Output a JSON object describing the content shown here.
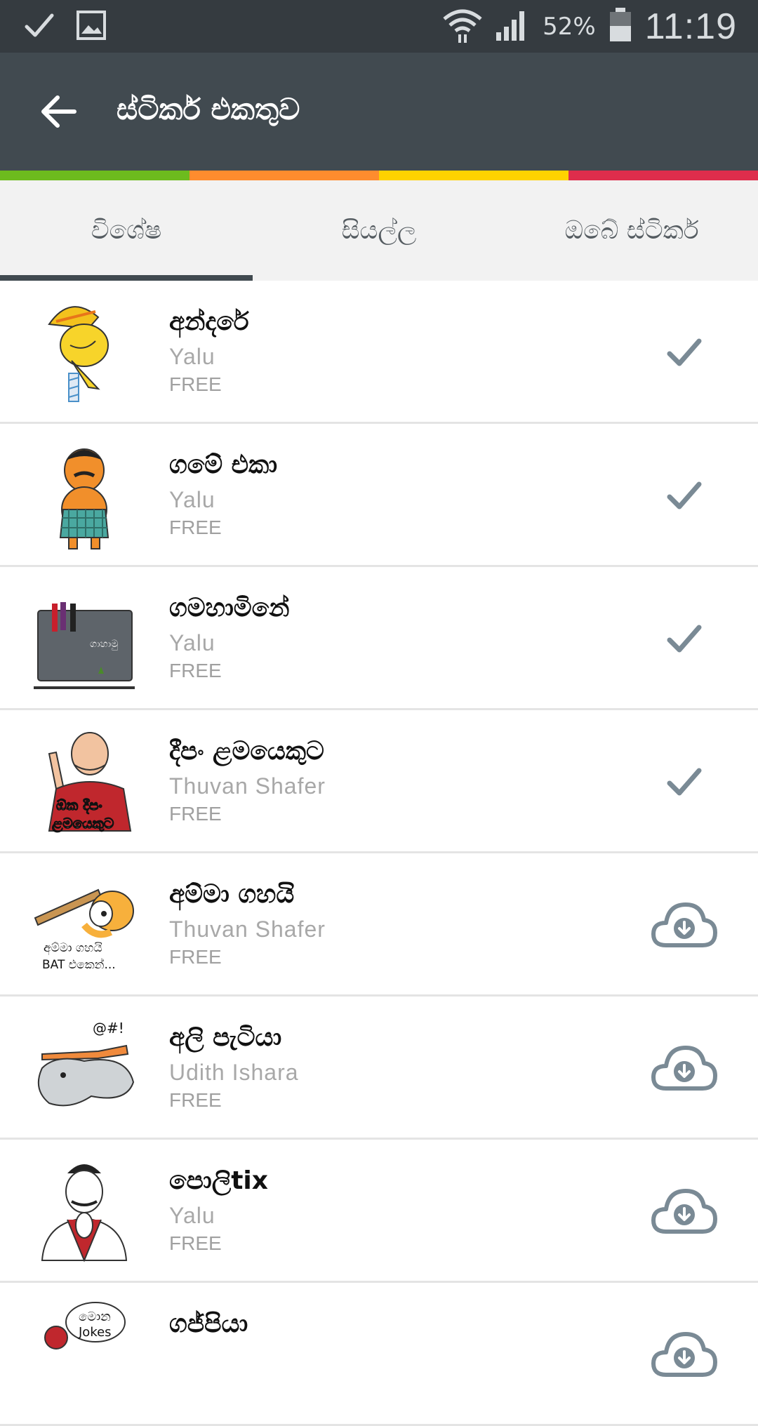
{
  "status_bar": {
    "battery_percent": "52%",
    "time": "11:19",
    "icons": [
      "check-icon",
      "image-icon",
      "wifi-icon",
      "signal-icon",
      "battery-icon"
    ]
  },
  "app_bar": {
    "title": "ස්ටිකර් එකතුව",
    "back_icon": "back-arrow-icon"
  },
  "color_strip": [
    "#6dbb1e",
    "#ff8c2e",
    "#ffd200",
    "#de2d4c"
  ],
  "tabs": [
    {
      "label": "විශේෂ",
      "active": true
    },
    {
      "label": "සියල්ල",
      "active": false
    },
    {
      "label": "ඔබේ ස්ටිකර්",
      "active": false
    }
  ],
  "stickers": [
    {
      "name": "අන්දරේ",
      "author": "Yalu",
      "price": "FREE",
      "status": "installed"
    },
    {
      "name": "ගමේ එකා",
      "author": "Yalu",
      "price": "FREE",
      "status": "installed"
    },
    {
      "name": "ගමහාමිනේ",
      "author": "Yalu",
      "price": "FREE",
      "status": "installed"
    },
    {
      "name": "දීපං ළමයෙකුට",
      "author": "Thuvan Shafer",
      "price": "FREE",
      "status": "installed"
    },
    {
      "name": "අම්මා ගහයි",
      "author": "Thuvan Shafer",
      "price": "FREE",
      "status": "download"
    },
    {
      "name": "අලි පැටියා",
      "author": "Udith Ishara",
      "price": "FREE",
      "status": "download"
    },
    {
      "name": "පොලිtix",
      "author": "Yalu",
      "price": "FREE",
      "status": "download"
    },
    {
      "name": "ගජ්පියා",
      "author": "",
      "price": "",
      "status": "download"
    }
  ],
  "thumb_texts": {
    "gamahamine_bag": "ගාහාමු",
    "deepan_line1": "ඕක දීපං",
    "deepan_line2": "ළමයෙකුට",
    "amma_line1": "අම්මා ගහයි",
    "amma_line2": "BAT එකෙන්...",
    "ali_symbols": "@#!",
    "gajpiya_line1": "මොන",
    "gajpiya_line2": "Jokes"
  },
  "colors": {
    "status_bar_bg": "#353b40",
    "app_bar_bg": "#414a50",
    "tab_bg": "#f2f2f2",
    "icon_grey": "#7a8a95"
  }
}
